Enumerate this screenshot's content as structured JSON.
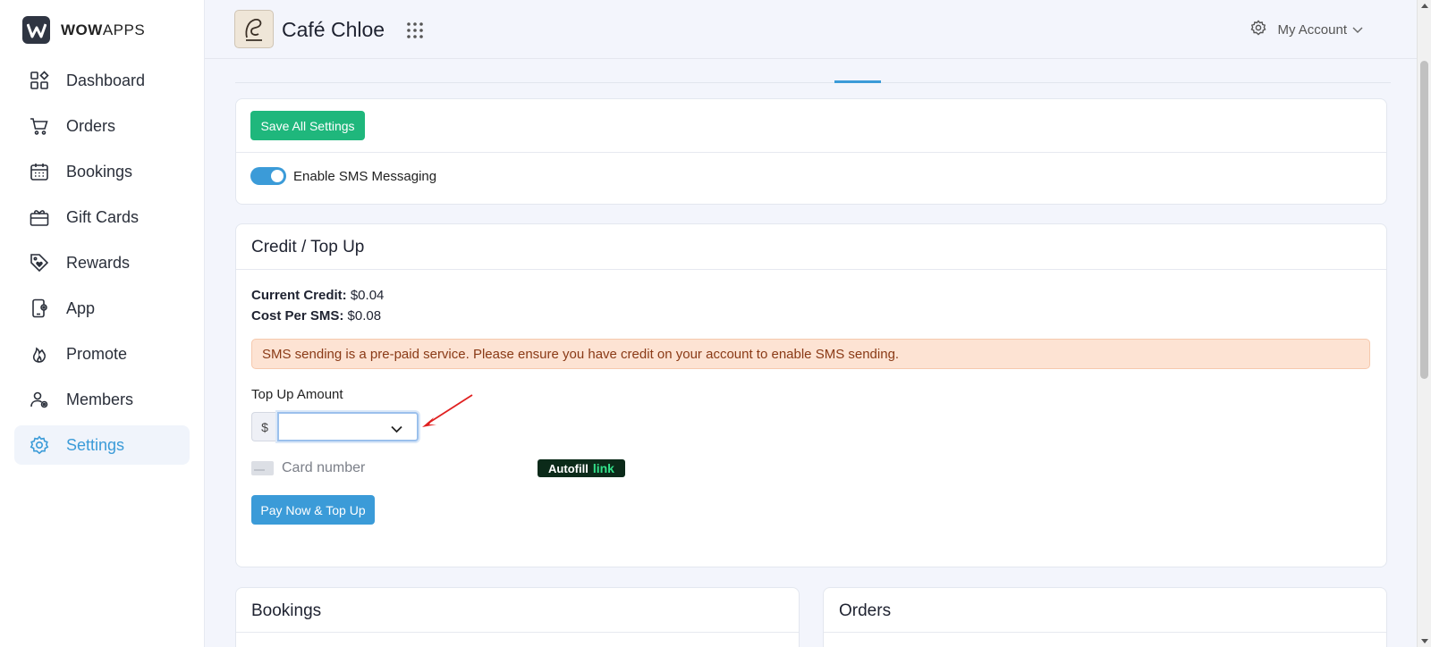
{
  "brand": {
    "name_bold": "WOW",
    "name_rest": "APPS"
  },
  "sidebar": {
    "items": [
      {
        "label": "Dashboard",
        "icon": "dashboard-icon"
      },
      {
        "label": "Orders",
        "icon": "cart-icon"
      },
      {
        "label": "Bookings",
        "icon": "calendar-icon"
      },
      {
        "label": "Gift Cards",
        "icon": "gift-card-icon"
      },
      {
        "label": "Rewards",
        "icon": "tag-heart-icon"
      },
      {
        "label": "App",
        "icon": "phone-gear-icon"
      },
      {
        "label": "Promote",
        "icon": "flame-icon"
      },
      {
        "label": "Members",
        "icon": "members-icon"
      },
      {
        "label": "Settings",
        "icon": "gear-icon",
        "active": true
      }
    ]
  },
  "header": {
    "store_name": "Café Chloe",
    "account_label": "My Account"
  },
  "settings_card": {
    "save_label": "Save All Settings",
    "toggle_label": "Enable SMS Messaging",
    "toggle_on": true
  },
  "credit_card": {
    "title": "Credit / Top Up",
    "current_credit_label": "Current Credit:",
    "current_credit_value": "$0.04",
    "cost_label": "Cost Per SMS:",
    "cost_value": "$0.08",
    "alert": "SMS sending is a pre-paid service. Please ensure you have credit on your account to enable SMS sending.",
    "topup_label": "Top Up Amount",
    "currency_prefix": "$",
    "topup_value": "",
    "card_placeholder": "Card number",
    "autofill_word": "Autofill",
    "autofill_link": "link",
    "pay_label": "Pay Now & Top Up"
  },
  "bookings_card": {
    "title": "Bookings"
  },
  "orders_card": {
    "title": "Orders"
  },
  "colors": {
    "accent": "#3b9bd8",
    "save_green": "#1fb77c",
    "alert_bg": "#fde3d3",
    "arrow_red": "#e02020"
  }
}
